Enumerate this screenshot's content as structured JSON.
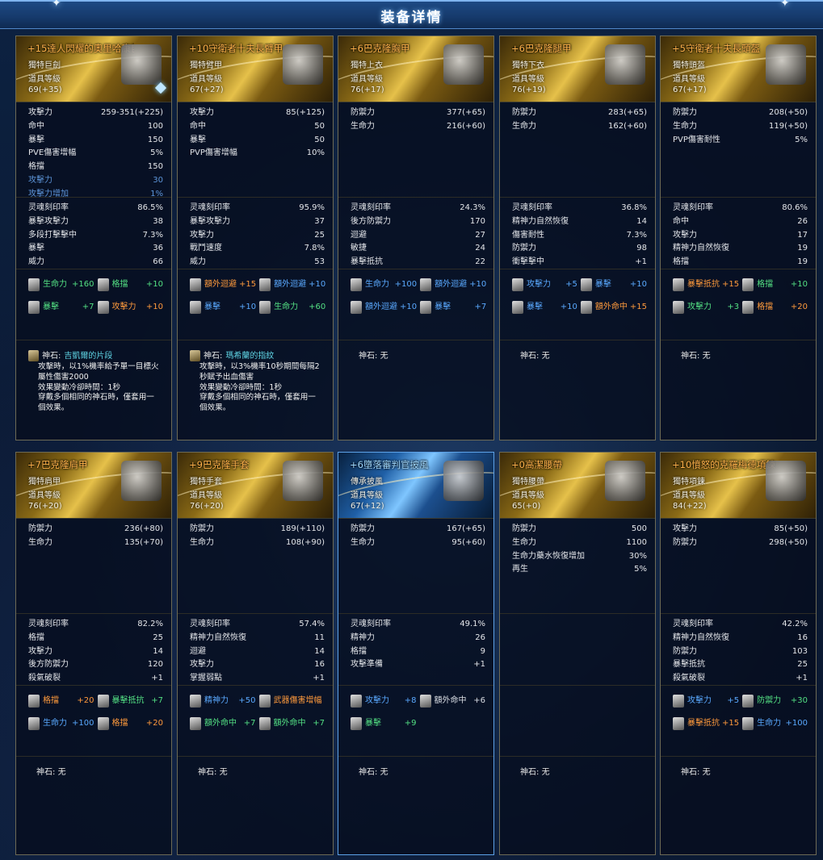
{
  "window": {
    "title": "装备详情"
  },
  "items": [
    {
      "name": "+15達人閃耀的奧里哈康巨劍",
      "name_color": "orange",
      "type": "獨特巨劍",
      "grade_label": "道具等級",
      "grade": "69(+35)",
      "theme": "gold",
      "icon": "greatsword-icon",
      "stats": [
        {
          "l": "攻擊力",
          "v": "259-351(+225)"
        },
        {
          "l": "命中",
          "v": "100"
        },
        {
          "l": "暴擊",
          "v": "150"
        },
        {
          "l": "PVE傷害增幅",
          "v": "5%"
        },
        {
          "l": "格擋",
          "v": "150"
        },
        {
          "l": "攻擊力",
          "v": "30",
          "blue": true
        },
        {
          "l": "攻擊力增加",
          "v": "1%",
          "blue": true
        }
      ],
      "soul": [
        {
          "l": "灵魂刻印率",
          "v": "86.5%"
        },
        {
          "l": "暴擊攻擊力",
          "v": "38"
        },
        {
          "l": "多段打擊擊中",
          "v": "7.3%"
        },
        {
          "l": "暴擊",
          "v": "36"
        },
        {
          "l": "威力",
          "v": "66"
        }
      ],
      "bonus": [
        {
          "l": "生命力",
          "v": "+160",
          "c": "green"
        },
        {
          "l": "格擋",
          "v": "+10",
          "c": "green"
        },
        {
          "l": "暴擊",
          "v": "+7",
          "c": "green"
        },
        {
          "l": "攻擊力",
          "v": "+10",
          "c": "orange"
        }
      ],
      "stone_label": "神石:",
      "stone_name": "吉凱爾的片段",
      "stone_desc": "攻擊時，以1%機率給予單一目標火\n屬性傷害2000\n效果變動冷卻時間：1秒\n穿戴多個相同的神石時，僅套用一\n個效果。"
    },
    {
      "name": "+10守衛者十夫長臂甲",
      "name_color": "orange",
      "type": "獨特臂甲",
      "grade_label": "道具等級",
      "grade": "67(+27)",
      "theme": "gold",
      "icon": "armguard-icon",
      "stats": [
        {
          "l": "攻擊力",
          "v": "85(+125)"
        },
        {
          "l": "命中",
          "v": "50"
        },
        {
          "l": "暴擊",
          "v": "50"
        },
        {
          "l": "PVP傷害增幅",
          "v": "10%"
        }
      ],
      "soul": [
        {
          "l": "灵魂刻印率",
          "v": "95.9%"
        },
        {
          "l": "暴擊攻擊力",
          "v": "37"
        },
        {
          "l": "攻擊力",
          "v": "25"
        },
        {
          "l": "戰鬥速度",
          "v": "7.8%"
        },
        {
          "l": "威力",
          "v": "53"
        }
      ],
      "bonus": [
        {
          "l": "額外迴避",
          "v": "+15",
          "c": "orange"
        },
        {
          "l": "額外迴避",
          "v": "+10",
          "c": "blue"
        },
        {
          "l": "暴擊",
          "v": "+10",
          "c": "blue"
        },
        {
          "l": "生命力",
          "v": "+60",
          "c": "green"
        }
      ],
      "stone_label": "神石:",
      "stone_name": "瑪希蘭的指紋",
      "stone_desc": "攻擊時，以3%機率10秒期間每隔2\n秒賦予出血傷害\n效果變動冷卻時間：1秒\n穿戴多個相同的神石時，僅套用一\n個效果。"
    },
    {
      "name": "+6巴克隆胸甲",
      "name_color": "orange",
      "type": "獨特上衣",
      "grade_label": "道具等級",
      "grade": "76(+17)",
      "theme": "gold",
      "icon": "chestplate-icon",
      "stats": [
        {
          "l": "防禦力",
          "v": "377(+65)"
        },
        {
          "l": "生命力",
          "v": "216(+60)"
        }
      ],
      "soul": [
        {
          "l": "灵魂刻印率",
          "v": "24.3%"
        },
        {
          "l": "後方防禦力",
          "v": "170"
        },
        {
          "l": "迴避",
          "v": "27"
        },
        {
          "l": "敏捷",
          "v": "24"
        },
        {
          "l": "暴擊抵抗",
          "v": "22"
        }
      ],
      "bonus": [
        {
          "l": "生命力",
          "v": "+100",
          "c": "blue"
        },
        {
          "l": "額外迴避",
          "v": "+10",
          "c": "blue"
        },
        {
          "l": "額外迴避",
          "v": "+10",
          "c": "blue"
        },
        {
          "l": "暴擊",
          "v": "+7",
          "c": "blue"
        }
      ],
      "stone_label": "神石:",
      "stone_none": "无"
    },
    {
      "name": "+6巴克隆腿甲",
      "name_color": "orange",
      "type": "獨特下衣",
      "grade_label": "道具等級",
      "grade": "76(+19)",
      "theme": "gold",
      "icon": "leggings-icon",
      "stats": [
        {
          "l": "防禦力",
          "v": "283(+65)"
        },
        {
          "l": "生命力",
          "v": "162(+60)"
        }
      ],
      "soul": [
        {
          "l": "灵魂刻印率",
          "v": "36.8%"
        },
        {
          "l": "精神力自然恢復",
          "v": "14"
        },
        {
          "l": "傷害耐性",
          "v": "7.3%"
        },
        {
          "l": "防禦力",
          "v": "98"
        },
        {
          "l": "衝擊擊中",
          "v": "+1"
        }
      ],
      "bonus": [
        {
          "l": "攻擊力",
          "v": "+5",
          "c": "blue"
        },
        {
          "l": "暴擊",
          "v": "+10",
          "c": "blue"
        },
        {
          "l": "暴擊",
          "v": "+10",
          "c": "blue"
        },
        {
          "l": "額外命中",
          "v": "+15",
          "c": "orange"
        }
      ],
      "stone_label": "神石:",
      "stone_none": "无"
    },
    {
      "name": "+5守衛者十夫長頭盔",
      "name_color": "orange",
      "type": "獨特頭盔",
      "grade_label": "道具等級",
      "grade": "67(+17)",
      "theme": "gold",
      "icon": "helmet-icon",
      "stats": [
        {
          "l": "防禦力",
          "v": "208(+50)"
        },
        {
          "l": "生命力",
          "v": "119(+50)"
        },
        {
          "l": "PVP傷害耐性",
          "v": "5%"
        }
      ],
      "soul": [
        {
          "l": "灵魂刻印率",
          "v": "80.6%"
        },
        {
          "l": "命中",
          "v": "26"
        },
        {
          "l": "攻擊力",
          "v": "17"
        },
        {
          "l": "精神力自然恢復",
          "v": "19"
        },
        {
          "l": "格擋",
          "v": "19"
        }
      ],
      "bonus": [
        {
          "l": "暴擊抵抗",
          "v": "+15",
          "c": "orange"
        },
        {
          "l": "格擋",
          "v": "+10",
          "c": "green"
        },
        {
          "l": "攻擊力",
          "v": "+3",
          "c": "green"
        },
        {
          "l": "格擋",
          "v": "+20",
          "c": "orange"
        }
      ],
      "stone_label": "神石:",
      "stone_none": "无"
    },
    {
      "name": "+7巴克隆肩甲",
      "name_color": "orange",
      "type": "獨特肩甲",
      "grade_label": "道具等級",
      "grade": "76(+20)",
      "theme": "gold",
      "icon": "shoulder-armor-icon",
      "stats": [
        {
          "l": "防禦力",
          "v": "236(+80)"
        },
        {
          "l": "生命力",
          "v": "135(+70)"
        }
      ],
      "soul": [
        {
          "l": "灵魂刻印率",
          "v": "82.2%"
        },
        {
          "l": "格擋",
          "v": "25"
        },
        {
          "l": "攻擊力",
          "v": "14"
        },
        {
          "l": "後方防禦力",
          "v": "120"
        },
        {
          "l": "殺氣破裂",
          "v": "+1"
        }
      ],
      "bonus": [
        {
          "l": "格擋",
          "v": "+20",
          "c": "orange"
        },
        {
          "l": "暴擊抵抗",
          "v": "+7",
          "c": "green"
        },
        {
          "l": "生命力",
          "v": "+100",
          "c": "blue"
        },
        {
          "l": "格擋",
          "v": "+20",
          "c": "orange"
        }
      ],
      "stone_label": "神石:",
      "stone_none": "无"
    },
    {
      "name": "+9巴克隆手套",
      "name_color": "orange",
      "type": "獨特手套",
      "grade_label": "道具等級",
      "grade": "76(+20)",
      "theme": "gold",
      "icon": "gloves-icon",
      "stats": [
        {
          "l": "防禦力",
          "v": "189(+110)"
        },
        {
          "l": "生命力",
          "v": "108(+90)"
        }
      ],
      "soul": [
        {
          "l": "灵魂刻印率",
          "v": "57.4%"
        },
        {
          "l": "精神力自然恢復",
          "v": "11"
        },
        {
          "l": "迴避",
          "v": "14"
        },
        {
          "l": "攻擊力",
          "v": "16"
        },
        {
          "l": "掌握弱點",
          "v": "+1"
        }
      ],
      "bonus": [
        {
          "l": "精神力",
          "v": "+50",
          "c": "blue"
        },
        {
          "l": "武器傷害增幅",
          "v": "",
          "c": "orange"
        },
        {
          "l": "額外命中",
          "v": "+7",
          "c": "green"
        },
        {
          "l": "額外命中",
          "v": "+7",
          "c": "green"
        }
      ],
      "stone_label": "神石:",
      "stone_none": "无"
    },
    {
      "name": "+6墮落審判官披風",
      "name_color": "blue",
      "type": "傳承披風",
      "grade_label": "道具等級",
      "grade": "67(+12)",
      "theme": "blue",
      "icon": "cloak-icon",
      "selected": true,
      "stats": [
        {
          "l": "防禦力",
          "v": "167(+65)"
        },
        {
          "l": "生命力",
          "v": "95(+60)"
        }
      ],
      "soul": [
        {
          "l": "灵魂刻印率",
          "v": "49.1%"
        },
        {
          "l": "精神力",
          "v": "26"
        },
        {
          "l": "格擋",
          "v": "9"
        },
        {
          "l": "攻擊準備",
          "v": "+1"
        }
      ],
      "bonus": [
        {
          "l": "攻擊力",
          "v": "+8",
          "c": "blue"
        },
        {
          "l": "額外命中",
          "v": "+6",
          "c": "white"
        },
        {
          "l": "暴擊",
          "v": "+9",
          "c": "green"
        }
      ],
      "stone_label": "神石:",
      "stone_none": "无"
    },
    {
      "name": "+0高潔腰帶",
      "name_color": "orange",
      "type": "獨特腰帶",
      "grade_label": "道具等級",
      "grade": "65(+0)",
      "theme": "gold",
      "icon": "belt-icon",
      "stats": [
        {
          "l": "防禦力",
          "v": "500"
        },
        {
          "l": "生命力",
          "v": "1100"
        },
        {
          "l": "生命力藥水恢復增加",
          "v": "30%"
        },
        {
          "l": "再生",
          "v": "5%"
        }
      ],
      "soul": [],
      "bonus": [],
      "stone_label": "神石:",
      "stone_none": "无"
    },
    {
      "name": "+10憤怒的克羅梅德項鍊",
      "name_color": "orange",
      "type": "獨特項鍊",
      "grade_label": "道具等級",
      "grade": "84(+22)",
      "theme": "gold",
      "icon": "necklace-icon",
      "stats": [
        {
          "l": "攻擊力",
          "v": "85(+50)"
        },
        {
          "l": "防禦力",
          "v": "298(+50)"
        }
      ],
      "soul": [
        {
          "l": "灵魂刻印率",
          "v": "42.2%"
        },
        {
          "l": "精神力自然恢復",
          "v": "16"
        },
        {
          "l": "防禦力",
          "v": "103"
        },
        {
          "l": "暴擊抵抗",
          "v": "25"
        },
        {
          "l": "殺氣破裂",
          "v": "+1"
        }
      ],
      "bonus": [
        {
          "l": "攻擊力",
          "v": "+5",
          "c": "blue"
        },
        {
          "l": "防禦力",
          "v": "+30",
          "c": "green"
        },
        {
          "l": "暴擊抵抗",
          "v": "+15",
          "c": "orange"
        },
        {
          "l": "生命力",
          "v": "+100",
          "c": "blue"
        }
      ],
      "stone_label": "神石:",
      "stone_none": "无"
    }
  ]
}
